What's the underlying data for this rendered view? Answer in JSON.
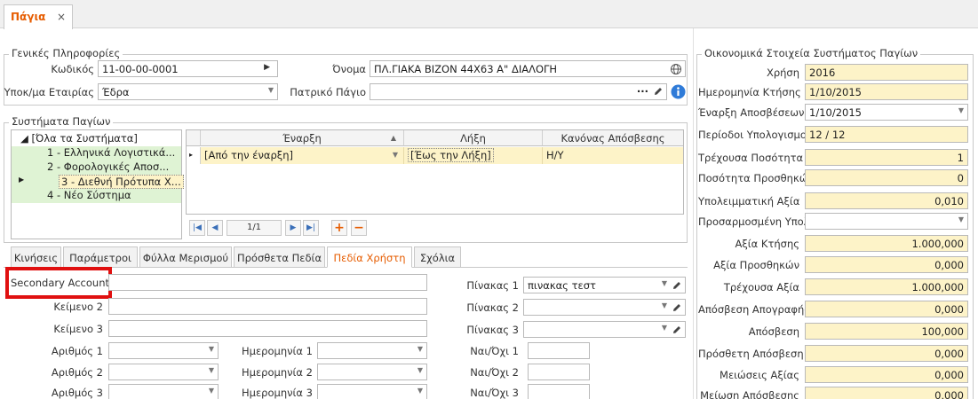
{
  "document_tab": {
    "label": "Πάγια",
    "close": "×"
  },
  "general": {
    "title": "Γενικές Πληροφορίες",
    "code_label": "Κωδικός",
    "code_value": "11-00-00-0001",
    "name_label": "Όνομα",
    "name_value": "ΠΛ.ΓΙΑΚΑ ΒΙΖΟΝ 44Χ63 Α\" ΔΙΑΛΟΓΗ",
    "branch_label": "Υποκ/μα Εταιρίας",
    "branch_value": "Έδρα",
    "parent_label": "Πατρικό Πάγιο",
    "parent_value": "",
    "dots": "···"
  },
  "systems": {
    "title": "Συστήματα Παγίων",
    "tree": [
      "◢ [Όλα τα Συστήματα]",
      "1 - Ελληνικά Λογιστικά...",
      "2 - Φορολογικές Αποσ...",
      "3 - Διεθνή Πρότυπα Χ...",
      "4 - Νέο Σύστημα"
    ],
    "columns": [
      "Έναρξη",
      "Λήξη",
      "Κανόνας Απόσβεσης"
    ],
    "row": [
      "[Από την έναρξη]",
      "[Έως την Λήξη]",
      "Η/Υ"
    ],
    "nav_page": "1/1",
    "nav_first": "|◀",
    "nav_prev": "◀",
    "nav_next": "▶",
    "nav_last": "▶|",
    "add": "+",
    "remove": "−",
    "sort_arrow": "▲",
    "row_arrow": "▸"
  },
  "tabs": [
    "Κινήσεις",
    "Παράμετροι",
    "Φύλλα Μερισμού",
    "Πρόσθετα Πεδία",
    "Πεδία Χρήστη",
    "Σχόλια"
  ],
  "user_fields": {
    "secondary_account_label": "Secondary Account",
    "text2_label": "Κείμενο 2",
    "text3_label": "Κείμενο 3",
    "number1_label": "Αριθμός 1",
    "number2_label": "Αριθμός 2",
    "number3_label": "Αριθμός 3",
    "date1_label": "Ημερομηνία 1",
    "date2_label": "Ημερομηνία 2",
    "date3_label": "Ημερομηνία 3",
    "table1_label": "Πίνακας 1",
    "table1_value": "πινακας τεστ",
    "table2_label": "Πίνακας 2",
    "table3_label": "Πίνακας 3",
    "yesno1_label": "Ναι/Όχι 1",
    "yesno2_label": "Ναι/Όχι 2",
    "yesno3_label": "Ναι/Όχι 3"
  },
  "financial": {
    "title": "Οικονομικά Στοιχεία Συστήματος Παγίων",
    "rows": [
      {
        "label": "Χρήση",
        "value": "2016"
      },
      {
        "label": "Ημερομηνία Κτήσης",
        "value": "1/10/2015"
      },
      {
        "label": "Έναρξη Αποσβέσεων",
        "value": "1/10/2015"
      },
      {
        "label": "Περίοδοι Υπολογισμού",
        "value": "12 / 12"
      },
      {
        "label": "Τρέχουσα Ποσότητα",
        "value": "1"
      },
      {
        "label": "Ποσότητα Προσθηκών",
        "value": "0"
      },
      {
        "label": "Υπολειμματική Αξία",
        "value": "0,010"
      },
      {
        "label": "Προσαρμοσμένη Υπολ. Αξία",
        "value": ""
      },
      {
        "label": "Αξία Κτήσης",
        "value": "1.000,000"
      },
      {
        "label": "Αξία Προσθηκών",
        "value": "0,000"
      },
      {
        "label": "Τρέχουσα Αξία",
        "value": "1.000,000"
      },
      {
        "label": "Απόσβεση Απογραφής",
        "value": "0,000"
      },
      {
        "label": "Απόσβεση",
        "value": "100,000"
      },
      {
        "label": "Πρόσθετη Απόσβεση",
        "value": "0,000"
      },
      {
        "label": "Μειώσεις Αξίας",
        "value": "0,000"
      },
      {
        "label": "Μείωση Απόσβεσης",
        "value": "0,000"
      }
    ]
  },
  "icons": {
    "globe": "globe-icon",
    "pencil": "pencil-icon",
    "info": "info-icon",
    "dropdown": "chevron-down-icon"
  },
  "colors": {
    "accent": "#e65c00",
    "highlight": "#e01010",
    "field_yellow": "#fdf3c8",
    "info_blue": "#2f7bd8",
    "nav_blue": "#3a6fb8"
  }
}
